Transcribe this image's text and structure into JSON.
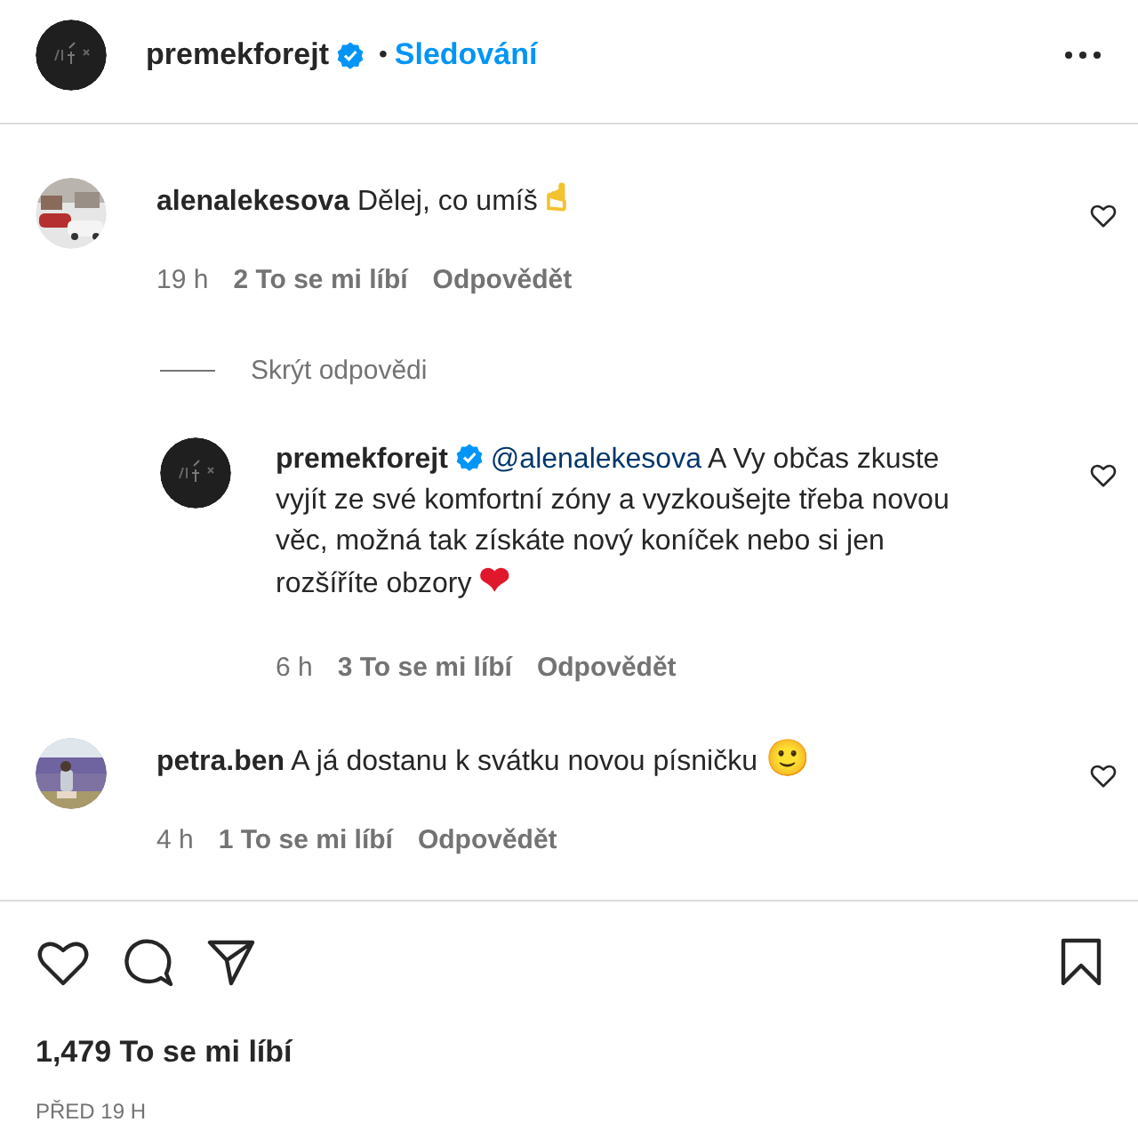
{
  "header": {
    "username": "premekforejt",
    "verified": true,
    "separator": "•",
    "follow_label": "Sledování"
  },
  "comments": [
    {
      "username": "alenalekesova",
      "verified": false,
      "text": "Dělej, co umíš",
      "emoji": {
        "char": "☝",
        "color": "#f2c230"
      },
      "time": "19 h",
      "likes": "2 To se mi líbí",
      "reply_label": "Odpovědět",
      "hide_replies": "Skrýt odpovědi",
      "replies": [
        {
          "username": "premekforejt",
          "verified": true,
          "mention": "@alenalekesova",
          "text": "A Vy občas zkuste vyjít ze své komfortní zóny a vyzkoušejte třeba novou věc, možná tak získáte nový koníček nebo si jen rozšíříte obzory",
          "emoji": {
            "char": "❤",
            "color": "#e0182b"
          },
          "time": "6 h",
          "likes": "3 To se mi líbí",
          "reply_label": "Odpovědět"
        }
      ]
    },
    {
      "username": "petra.ben",
      "verified": false,
      "text": "A já dostanu k svátku novou písničku",
      "emoji": {
        "char": "🙂",
        "color": "#e8b21c"
      },
      "time": "4 h",
      "likes": "1 To se mi líbí",
      "reply_label": "Odpovědět"
    }
  ],
  "actions": {
    "liked": false,
    "saved": false
  },
  "likes_total": "1,479 To se mi líbí",
  "posted": "PŘED 19 H"
}
